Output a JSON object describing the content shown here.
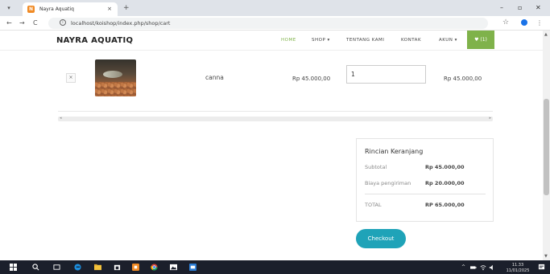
{
  "browser": {
    "tab_title": "Nayra Aquatiq",
    "tab_favicon": "N",
    "tab_close": "×",
    "new_tab": "+",
    "url": "localhost/koishop/index.php/shop/cart",
    "back": "←",
    "forward": "→",
    "reload": "C",
    "info": "i",
    "star": "☆",
    "menu": "⋮",
    "minimize": "–",
    "maximize": "▫",
    "close": "✕"
  },
  "site": {
    "brand": "NAYRA AQUATIQ",
    "nav": {
      "home": "HOME",
      "shop": "SHOP ▾",
      "about": "TENTANG KAMI",
      "contact": "KONTAK",
      "account": "AKUN ▾",
      "cart": "♥ (1)"
    },
    "accent_color": "#7fb24a",
    "checkout_color": "#1fa3b8"
  },
  "cart": {
    "remove_label": "×",
    "items": [
      {
        "name": "canna",
        "price": "Rp 45.000,00",
        "quantity": "1",
        "total": "Rp 45.000,00"
      }
    ]
  },
  "summary": {
    "title": "Rincian Keranjang",
    "subtotal_label": "Subtotal",
    "subtotal_value": "Rp 45.000,00",
    "shipping_label": "Biaya pengiriman",
    "shipping_value": "Rp 20.000,00",
    "total_label": "TOTAL",
    "total_value": "RP 65.000,00"
  },
  "checkout_label": "Checkout",
  "taskbar": {
    "time": "11.33",
    "date": "11/01/2025"
  }
}
